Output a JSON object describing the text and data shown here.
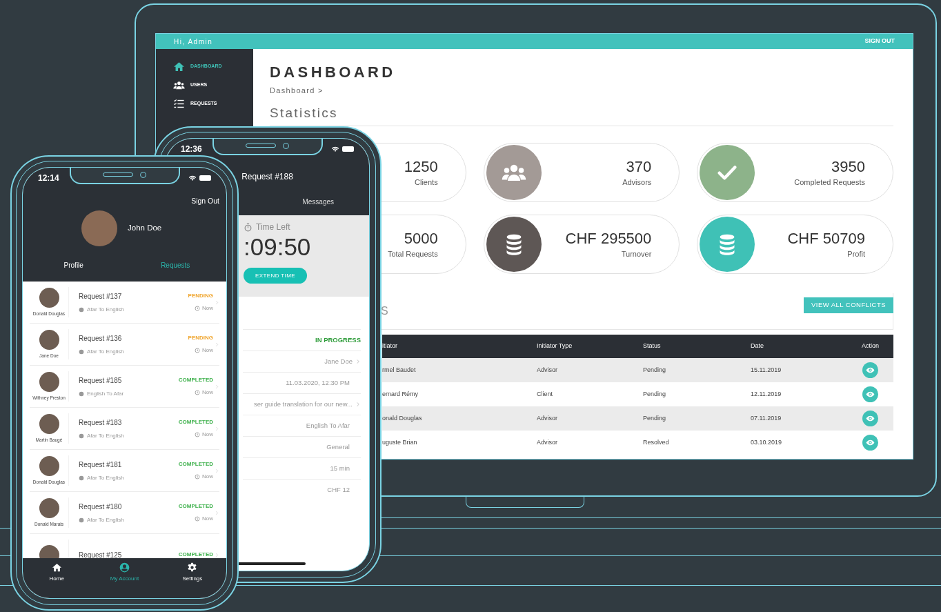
{
  "admin": {
    "greeting": "Hi, Admin",
    "sign_out": "SIGN OUT",
    "sidebar": [
      {
        "label": "DASHBOARD",
        "kind": "home",
        "selected": true
      },
      {
        "label": "USERS",
        "kind": "users",
        "selected": false
      },
      {
        "label": "REQUESTS",
        "kind": "list",
        "selected": false
      }
    ],
    "page_title": "DASHBOARD",
    "breadcrumb": "Dashboard >",
    "section_title": "Statistics",
    "stats": [
      {
        "value": "1250",
        "label": "Clients"
      },
      {
        "value": "370",
        "label": "Advisors",
        "kind": "users",
        "color": "#a39a96"
      },
      {
        "value": "3950",
        "label": "Completed Requests",
        "kind": "check",
        "color": "#8db38a"
      },
      {
        "value": "5000",
        "label": "Total Requests"
      },
      {
        "value": "CHF 295500",
        "label": "Turnover",
        "kind": "coins",
        "color": "#5e5755"
      },
      {
        "value": "CHF 50709",
        "label": "Profit",
        "kind": "coins",
        "color": "#3fc1b6"
      }
    ],
    "conflicts_heading": "S",
    "view_all_button": "VIEW ALL CONFLICTS",
    "table": {
      "columns": [
        "itiator",
        "Initiator Type",
        "Status",
        "Date",
        "Action"
      ],
      "rows": [
        {
          "cells": [
            "rmel Baudet",
            "Advisor",
            "Pending",
            "15.11.2019"
          ]
        },
        {
          "cells": [
            "ernard Rémy",
            "Client",
            "Pending",
            "12.11.2019"
          ]
        },
        {
          "cells": [
            "onald Douglas",
            "Advisor",
            "Pending",
            "07.11.2019"
          ]
        },
        {
          "cells": [
            "uguste Brian",
            "Advisor",
            "Resolved",
            "03.10.2019"
          ]
        }
      ]
    }
  },
  "request_phone": {
    "time": "12:36",
    "title": "Request #188",
    "tabs": [
      {
        "label": "Messages"
      }
    ],
    "timer_label": "Time Left",
    "timer_value": ":09:50",
    "extend_button": "EXTEND TIME",
    "details": [
      {
        "value": "IN PROGRESS",
        "kind": "status"
      },
      {
        "value": "Jane Doe",
        "kind": "link"
      },
      {
        "value": "11.03.2020, 12:30 PM",
        "kind": "plain"
      },
      {
        "value": "ser guide translation for our new...",
        "kind": "link"
      },
      {
        "value": "English To Afar",
        "kind": "plain"
      },
      {
        "value": "General",
        "kind": "plain"
      },
      {
        "value": "15 min",
        "kind": "plain"
      },
      {
        "value": "CHF 12",
        "kind": "plain"
      }
    ]
  },
  "account_phone": {
    "time": "12:14",
    "sign_out": "Sign Out",
    "user_name": "John Doe",
    "tabs": [
      {
        "label": "Profile",
        "selected": false
      },
      {
        "label": "Requests",
        "selected": true
      }
    ],
    "requests": [
      {
        "person": "Donald Douglas",
        "title": "Request #137",
        "languages": "Afar To English",
        "status": "PENDING",
        "kind": "pending",
        "time": "Now"
      },
      {
        "person": "Jane Doe",
        "title": "Request #136",
        "languages": "Afar To English",
        "status": "PENDING",
        "kind": "pending",
        "time": "Now"
      },
      {
        "person": "Withney Preston",
        "title": "Request #185",
        "languages": "English To Afar",
        "status": "COMPLETED",
        "kind": "completed",
        "time": "Now"
      },
      {
        "person": "Martin Baugé",
        "title": "Request #183",
        "languages": "Afar To English",
        "status": "COMPLETED",
        "kind": "completed",
        "time": "Now"
      },
      {
        "person": "Donald Douglas",
        "title": "Request #181",
        "languages": "Afar To English",
        "status": "COMPLETED",
        "kind": "completed",
        "time": "Now"
      },
      {
        "person": "Donald Marais",
        "title": "Request #180",
        "languages": "Afar To English",
        "status": "COMPLETED",
        "kind": "completed",
        "time": "Now"
      },
      {
        "title": "Request #125",
        "status": "COMPLETED",
        "kind": "completed"
      }
    ],
    "nav": [
      {
        "label": "Home",
        "kind": "home",
        "selected": false
      },
      {
        "label": "My Account",
        "kind": "account",
        "selected": true
      },
      {
        "label": "Settings",
        "kind": "gear",
        "selected": false
      }
    ]
  }
}
